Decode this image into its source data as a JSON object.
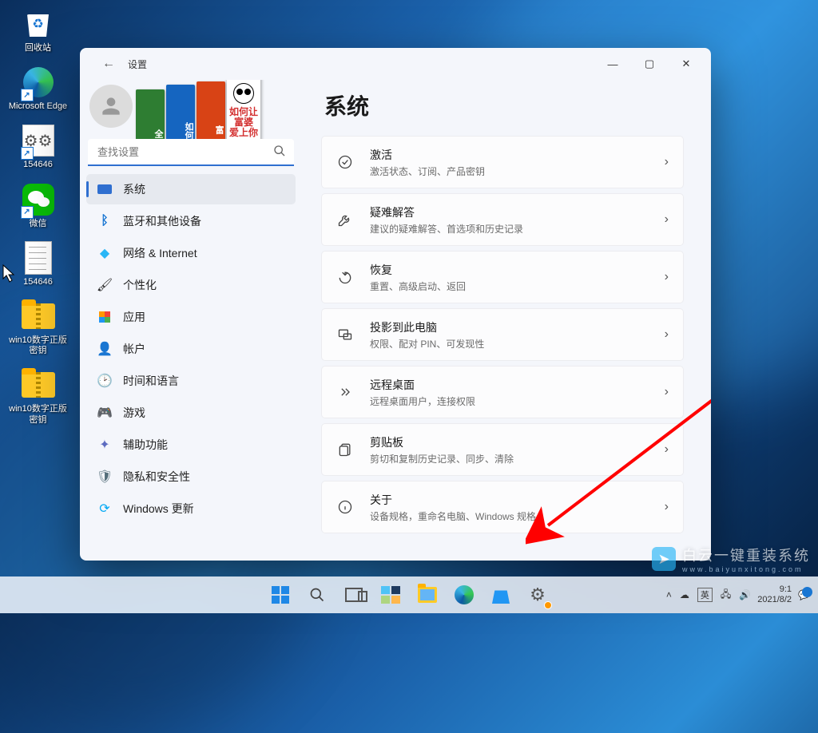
{
  "desktop": {
    "items": [
      {
        "label": "回收站"
      },
      {
        "label": "Microsoft Edge"
      },
      {
        "label": "154646"
      },
      {
        "label": "微信"
      },
      {
        "label": "154646"
      },
      {
        "label": "win10数字正版密钥"
      },
      {
        "label": "win10数字正版密钥"
      }
    ]
  },
  "window": {
    "title": "设置",
    "search_placeholder": "查找设置",
    "heading": "系统",
    "nav": [
      {
        "label": "系统"
      },
      {
        "label": "蓝牙和其他设备"
      },
      {
        "label": "网络 & Internet"
      },
      {
        "label": "个性化"
      },
      {
        "label": "应用"
      },
      {
        "label": "帐户"
      },
      {
        "label": "时间和语言"
      },
      {
        "label": "游戏"
      },
      {
        "label": "辅助功能"
      },
      {
        "label": "隐私和安全性"
      },
      {
        "label": "Windows 更新"
      }
    ],
    "cards": [
      {
        "title": "激活",
        "desc": "激活状态、订阅、产品密钥"
      },
      {
        "title": "疑难解答",
        "desc": "建议的疑难解答、首选项和历史记录"
      },
      {
        "title": "恢复",
        "desc": "重置、高级启动、返回"
      },
      {
        "title": "投影到此电脑",
        "desc": "权限、配对 PIN、可发现性"
      },
      {
        "title": "远程桌面",
        "desc": "远程桌面用户，连接权限"
      },
      {
        "title": "剪贴板",
        "desc": "剪切和复制历史记录、同步、清除"
      },
      {
        "title": "关于",
        "desc": "设备规格，重命名电脑、Windows 规格"
      }
    ],
    "book4": {
      "l1": "如何让",
      "l2": "富婆",
      "l3": "爱上你"
    }
  },
  "taskbar": {
    "ime": "英",
    "time": "9:1",
    "date": "2021/8/2"
  },
  "watermark": {
    "main": "白云一键重装系统",
    "sub": "www.baiyunxitong.com"
  }
}
